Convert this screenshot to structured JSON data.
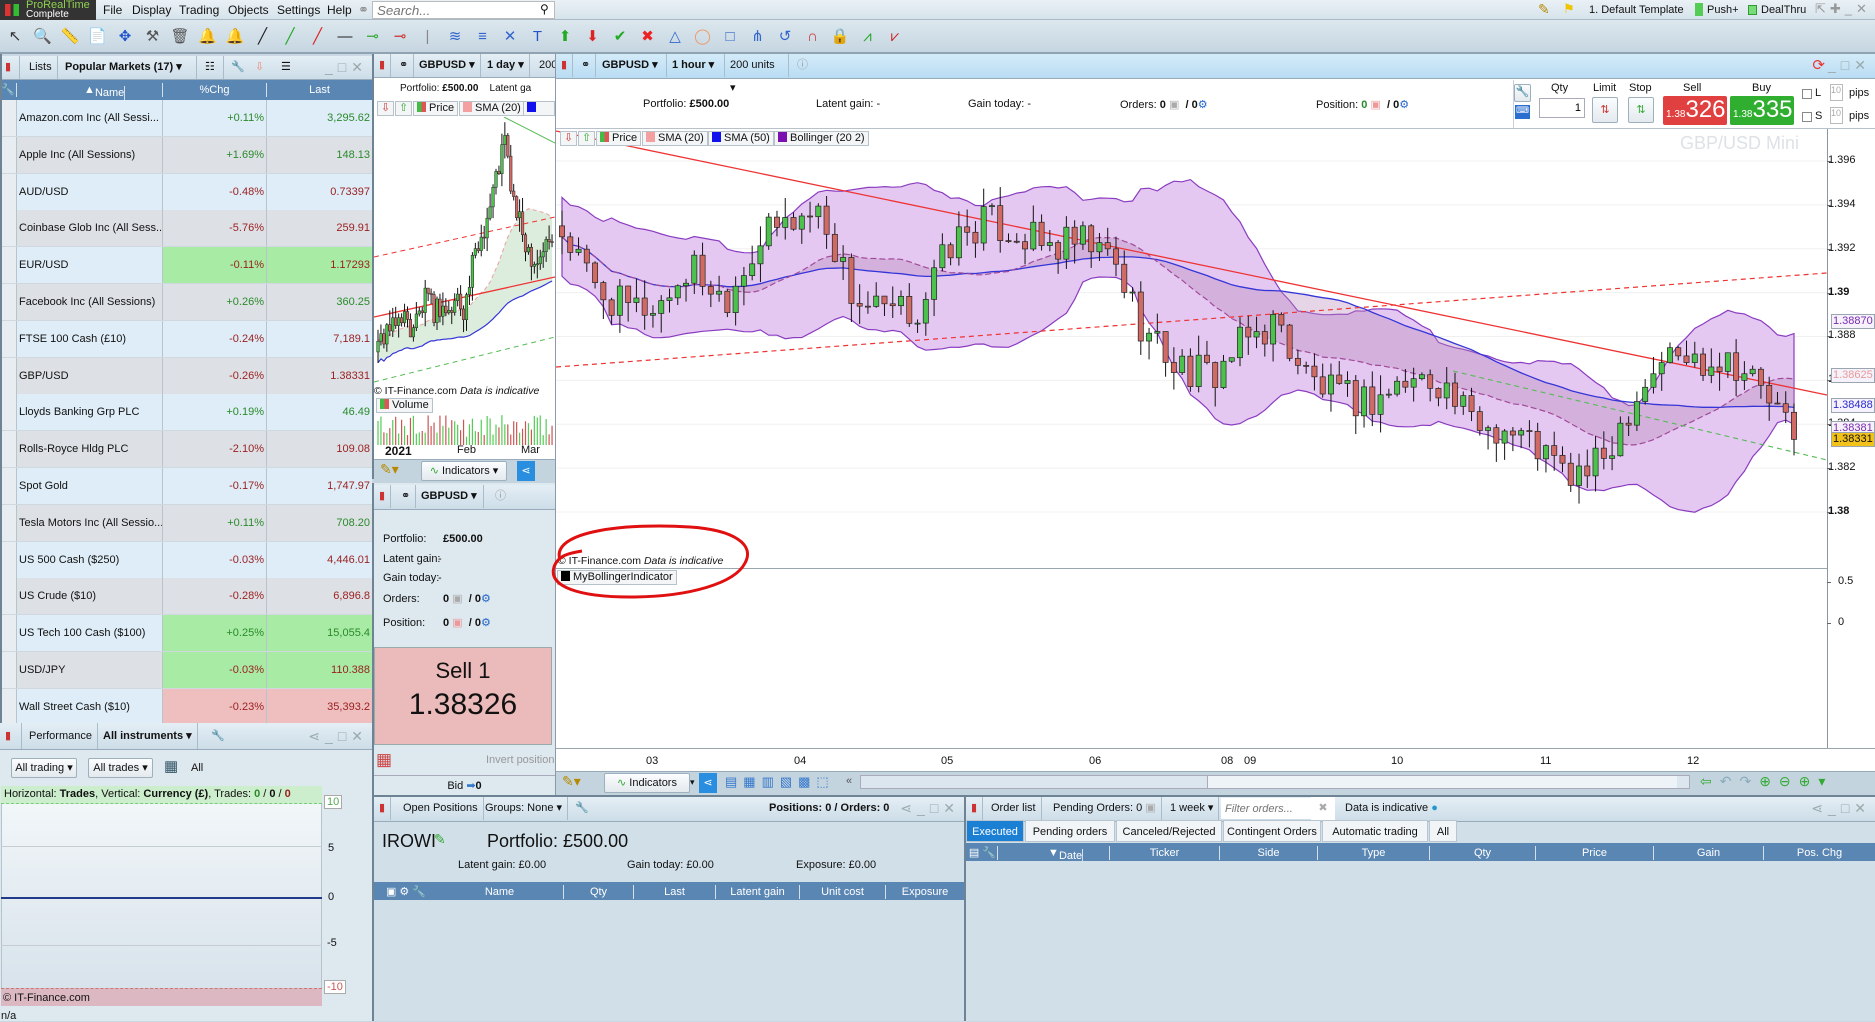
{
  "app": {
    "logo_line1": "ProRealTime",
    "logo_line2": "Complete"
  },
  "menu": [
    "File",
    "Display",
    "Trading",
    "Objects",
    "Settings",
    "Help"
  ],
  "search": {
    "placeholder": "Search..."
  },
  "topright": {
    "template": "1. Default Template",
    "push": "Push+",
    "dealthru": "DealThru"
  },
  "watchlist": {
    "lists_label": "Lists",
    "list_name": "Popular Markets (17)",
    "columns": [
      "Name",
      "%Chg",
      "Last"
    ],
    "rows": [
      {
        "name": "Amazon.com Inc (All Sessi...",
        "chg": "+0.11%",
        "last": "3,295.62",
        "dir": "up",
        "flash": ""
      },
      {
        "name": "Apple Inc (All Sessions)",
        "chg": "+1.69%",
        "last": "148.13",
        "dir": "up",
        "flash": ""
      },
      {
        "name": "AUD/USD",
        "chg": "-0.48%",
        "last": "0.73397",
        "dir": "dn",
        "flash": ""
      },
      {
        "name": "Coinbase Glob Inc (All Sess...",
        "chg": "-5.76%",
        "last": "259.91",
        "dir": "dn",
        "flash": ""
      },
      {
        "name": "EUR/USD",
        "chg": "-0.11%",
        "last": "1.17293",
        "dir": "dn",
        "flash": "green"
      },
      {
        "name": "Facebook Inc (All Sessions)",
        "chg": "+0.26%",
        "last": "360.25",
        "dir": "up",
        "flash": ""
      },
      {
        "name": "FTSE 100 Cash (£10)",
        "chg": "-0.24%",
        "last": "7,189.1",
        "dir": "dn",
        "flash": ""
      },
      {
        "name": "GBP/USD",
        "chg": "-0.26%",
        "last": "1.38331",
        "dir": "dn",
        "flash": ""
      },
      {
        "name": "Lloyds Banking Grp PLC",
        "chg": "+0.19%",
        "last": "46.49",
        "dir": "up",
        "flash": ""
      },
      {
        "name": "Rolls-Royce Hldg PLC",
        "chg": "-2.10%",
        "last": "109.08",
        "dir": "dn",
        "flash": ""
      },
      {
        "name": "Spot Gold",
        "chg": "-0.17%",
        "last": "1,747.97",
        "dir": "dn",
        "flash": ""
      },
      {
        "name": "Tesla Motors Inc (All Sessio...",
        "chg": "+0.11%",
        "last": "708.20",
        "dir": "up",
        "flash": ""
      },
      {
        "name": "US 500 Cash ($250)",
        "chg": "-0.03%",
        "last": "4,446.01",
        "dir": "dn",
        "flash": ""
      },
      {
        "name": "US Crude ($10)",
        "chg": "-0.28%",
        "last": "6,896.8",
        "dir": "dn",
        "flash": ""
      },
      {
        "name": "US Tech 100 Cash ($100)",
        "chg": "+0.25%",
        "last": "15,055.4",
        "dir": "up",
        "flash": "green"
      },
      {
        "name": "USD/JPY",
        "chg": "-0.03%",
        "last": "110.388",
        "dir": "dn",
        "flash": "green"
      },
      {
        "name": "Wall Street Cash ($10)",
        "chg": "-0.23%",
        "last": "35,393.2",
        "dir": "dn",
        "flash": "red"
      }
    ]
  },
  "performance": {
    "title": "Performance",
    "instruments": "All instruments",
    "filter1": "All trading",
    "filter2": "All trades",
    "period": "All",
    "caption_prefix": "Horizontal: ",
    "caption_h": "Trades",
    "caption_mid": ", Vertical: ",
    "caption_v": "Currency (£)",
    "caption_trades": ", Trades: ",
    "trades_win": "0",
    "trades_sep": " / ",
    "trades_zero": "0",
    "trades_loss": "0",
    "y_ticks": [
      "10",
      "5",
      "0",
      "-5",
      "-10"
    ],
    "copyright": "© IT-Finance.com",
    "footer": "n/a"
  },
  "mini_chart": {
    "symbol": "GBPUSD",
    "timeframe": "1 day",
    "units": "200",
    "portfolio_label": "Portfolio:",
    "portfolio_value": "£500.00",
    "latent_label": "Latent ga",
    "legend": [
      "Price",
      "SMA (20)",
      "SM"
    ],
    "copyright": "© IT-Finance.com",
    "indicative": "Data is indicative",
    "volume_label": "Volume",
    "x_labels": [
      "2021",
      "Feb",
      "Mar"
    ],
    "indicators_label": "Indicators"
  },
  "mini_trade": {
    "symbol": "GBPUSD",
    "portfolio_label": "Portfolio:",
    "portfolio_value": "£500.00",
    "latent_label": "Latent gain:",
    "latent_value": "-",
    "gain_label": "Gain today:",
    "gain_value": "-",
    "orders_label": "Orders:",
    "orders_value": "0",
    "orders_auto": "/ 0",
    "position_label": "Position:",
    "position_value": "0",
    "position_auto": "/ 0",
    "sell_label": "Sell 1",
    "sell_price": "1.38326",
    "invert": "Invert position",
    "bid": "Bid",
    "bid_value": "0"
  },
  "main_chart": {
    "symbol": "GBPUSD",
    "timeframe": "1 hour",
    "units": "200 units",
    "portfolio_label": "Portfolio:",
    "portfolio_value": "£500.00",
    "latent": "Latent gain: -",
    "gain_today": "Gain today: -",
    "orders_label": "Orders:",
    "orders_value": "0",
    "orders_auto": "/ 0",
    "position_label": "Position:",
    "position_value": "0",
    "position_auto": "/ 0",
    "watermark": "GBP/USD Mini",
    "copyright": "© IT-Finance.com",
    "indicative": "Data is indicative",
    "indicator_name": "MyBollingerIndicator",
    "indicators_label": "Indicators",
    "trade": {
      "qty_label": "Qty",
      "qty_value": "1",
      "limit": "Limit",
      "stop": "Stop",
      "sell": "Sell",
      "buy": "Buy",
      "sell_big": "1.38",
      "sell_small": "326",
      "buy_big": "1.38",
      "buy_small": "335",
      "l": "L",
      "s": "S",
      "pips_value": "10",
      "pips": "pips"
    }
  },
  "chart_data": [
    {
      "type": "candlestick",
      "title": "GBPUSD 1 hour",
      "legend": [
        "Price",
        "SMA (20)",
        "SMA (50)",
        "Bollinger (20 2)"
      ],
      "approx_close_path": [
        1.39275,
        1.39021,
        1.38919,
        1.38945,
        1.39122,
        1.3897,
        1.39224,
        1.39326,
        1.39376,
        1.3897,
        1.38894,
        1.38919,
        1.39224,
        1.39326,
        1.39275,
        1.39199,
        1.39224,
        1.39148,
        1.38818,
        1.38665,
        1.38614,
        1.38767,
        1.38868,
        1.38614,
        1.38513,
        1.38513,
        1.38589,
        1.38614,
        1.38411,
        1.38386,
        1.3831,
        1.38157,
        1.38208,
        1.38513,
        1.38716,
        1.38691,
        1.38716,
        1.38564,
        1.38331
      ],
      "x_labels": [
        "03",
        "04",
        "05",
        "06",
        "08",
        "09",
        "10",
        "11",
        "12"
      ],
      "y_ticks": [
        "1.396",
        "1.394",
        "1.392",
        "1.39",
        "1.388",
        "1.386",
        "1.384",
        "1.382",
        "1.38"
      ],
      "ylim": [
        1.378,
        1.3975
      ],
      "price_labels": [
        {
          "value": "1.38870",
          "color": "#7a2bb0"
        },
        {
          "value": "1.38625",
          "color": "#7a2bb0"
        },
        {
          "value": "1.38625",
          "color": "#e79a9a"
        },
        {
          "value": "1.38488",
          "color": "#2a2ad0"
        },
        {
          "value": "1.38381",
          "color": "#7a2bb0"
        },
        {
          "value": "1.38331",
          "color": "#111111",
          "bg": "#f2c21b"
        }
      ],
      "indicator_ticks": [
        "0.5",
        "0"
      ]
    },
    {
      "type": "candlestick",
      "title": "GBPUSD 1 day",
      "approx_close_path": [
        1.36,
        1.368,
        1.366,
        1.372,
        1.367,
        1.37,
        1.375,
        1.372,
        1.374,
        1.371,
        1.376,
        1.373,
        1.385,
        1.393,
        1.4,
        1.41,
        1.42,
        1.404,
        1.395,
        1.39,
        1.386,
        1.39,
        1.392
      ]
    }
  ],
  "open_positions": {
    "title": "Open Positions",
    "groups": "Groups: None",
    "counts": "Positions: 0 / Orders: 0",
    "account": "IROWI",
    "portfolio": "Portfolio: £500.00",
    "latent": "Latent gain: £0.00",
    "gain": "Gain today: £0.00",
    "exposure": "Exposure: £0.00",
    "columns": [
      "Name",
      "Qty",
      "Last",
      "Latent gain",
      "Unit cost",
      "Exposure"
    ]
  },
  "order_list": {
    "title": "Order list",
    "pending": "Pending Orders: 0",
    "period": "1 week",
    "filter_placeholder": "Filter orders...",
    "indicative": "Data is indicative",
    "tabs": [
      "Executed",
      "Pending orders",
      "Canceled/Rejected",
      "Contingent Orders",
      "Automatic trading",
      "All"
    ],
    "columns": [
      "Date",
      "Ticker",
      "Side",
      "Type",
      "Qty",
      "Price",
      "Gain",
      "Pos. Chg"
    ]
  }
}
